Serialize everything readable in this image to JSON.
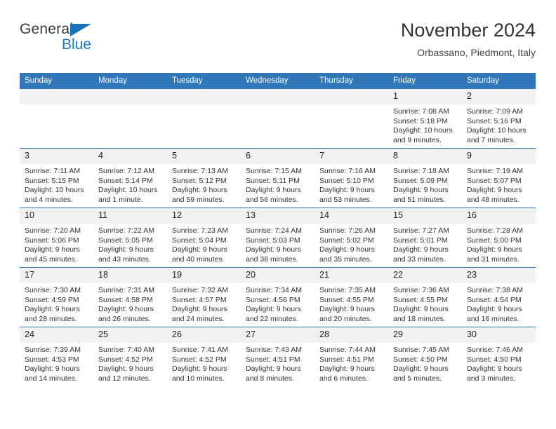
{
  "brand": {
    "line1": "General",
    "line2": "Blue",
    "flag_icon": "triangle-flag-icon",
    "accent_color": "#1a7bc4"
  },
  "header": {
    "title": "November 2024",
    "subtitle": "Orbassano, Piedmont, Italy"
  },
  "theme": {
    "header_blue": "#3176b7",
    "daynum_band": "#f1f1f1",
    "text": "#333333"
  },
  "calendar": {
    "weekday_headers": [
      "Sunday",
      "Monday",
      "Tuesday",
      "Wednesday",
      "Thursday",
      "Friday",
      "Saturday"
    ],
    "weeks": [
      [
        {
          "day": "",
          "blank": true
        },
        {
          "day": "",
          "blank": true
        },
        {
          "day": "",
          "blank": true
        },
        {
          "day": "",
          "blank": true
        },
        {
          "day": "",
          "blank": true
        },
        {
          "day": "1",
          "sunrise": "Sunrise: 7:08 AM",
          "sunset": "Sunset: 5:18 PM",
          "daylight": "Daylight: 10 hours and 9 minutes."
        },
        {
          "day": "2",
          "sunrise": "Sunrise: 7:09 AM",
          "sunset": "Sunset: 5:16 PM",
          "daylight": "Daylight: 10 hours and 7 minutes."
        }
      ],
      [
        {
          "day": "3",
          "sunrise": "Sunrise: 7:11 AM",
          "sunset": "Sunset: 5:15 PM",
          "daylight": "Daylight: 10 hours and 4 minutes."
        },
        {
          "day": "4",
          "sunrise": "Sunrise: 7:12 AM",
          "sunset": "Sunset: 5:14 PM",
          "daylight": "Daylight: 10 hours and 1 minute."
        },
        {
          "day": "5",
          "sunrise": "Sunrise: 7:13 AM",
          "sunset": "Sunset: 5:12 PM",
          "daylight": "Daylight: 9 hours and 59 minutes."
        },
        {
          "day": "6",
          "sunrise": "Sunrise: 7:15 AM",
          "sunset": "Sunset: 5:11 PM",
          "daylight": "Daylight: 9 hours and 56 minutes."
        },
        {
          "day": "7",
          "sunrise": "Sunrise: 7:16 AM",
          "sunset": "Sunset: 5:10 PM",
          "daylight": "Daylight: 9 hours and 53 minutes."
        },
        {
          "day": "8",
          "sunrise": "Sunrise: 7:18 AM",
          "sunset": "Sunset: 5:09 PM",
          "daylight": "Daylight: 9 hours and 51 minutes."
        },
        {
          "day": "9",
          "sunrise": "Sunrise: 7:19 AM",
          "sunset": "Sunset: 5:07 PM",
          "daylight": "Daylight: 9 hours and 48 minutes."
        }
      ],
      [
        {
          "day": "10",
          "sunrise": "Sunrise: 7:20 AM",
          "sunset": "Sunset: 5:06 PM",
          "daylight": "Daylight: 9 hours and 45 minutes."
        },
        {
          "day": "11",
          "sunrise": "Sunrise: 7:22 AM",
          "sunset": "Sunset: 5:05 PM",
          "daylight": "Daylight: 9 hours and 43 minutes."
        },
        {
          "day": "12",
          "sunrise": "Sunrise: 7:23 AM",
          "sunset": "Sunset: 5:04 PM",
          "daylight": "Daylight: 9 hours and 40 minutes."
        },
        {
          "day": "13",
          "sunrise": "Sunrise: 7:24 AM",
          "sunset": "Sunset: 5:03 PM",
          "daylight": "Daylight: 9 hours and 38 minutes."
        },
        {
          "day": "14",
          "sunrise": "Sunrise: 7:26 AM",
          "sunset": "Sunset: 5:02 PM",
          "daylight": "Daylight: 9 hours and 35 minutes."
        },
        {
          "day": "15",
          "sunrise": "Sunrise: 7:27 AM",
          "sunset": "Sunset: 5:01 PM",
          "daylight": "Daylight: 9 hours and 33 minutes."
        },
        {
          "day": "16",
          "sunrise": "Sunrise: 7:28 AM",
          "sunset": "Sunset: 5:00 PM",
          "daylight": "Daylight: 9 hours and 31 minutes."
        }
      ],
      [
        {
          "day": "17",
          "sunrise": "Sunrise: 7:30 AM",
          "sunset": "Sunset: 4:59 PM",
          "daylight": "Daylight: 9 hours and 28 minutes."
        },
        {
          "day": "18",
          "sunrise": "Sunrise: 7:31 AM",
          "sunset": "Sunset: 4:58 PM",
          "daylight": "Daylight: 9 hours and 26 minutes."
        },
        {
          "day": "19",
          "sunrise": "Sunrise: 7:32 AM",
          "sunset": "Sunset: 4:57 PM",
          "daylight": "Daylight: 9 hours and 24 minutes."
        },
        {
          "day": "20",
          "sunrise": "Sunrise: 7:34 AM",
          "sunset": "Sunset: 4:56 PM",
          "daylight": "Daylight: 9 hours and 22 minutes."
        },
        {
          "day": "21",
          "sunrise": "Sunrise: 7:35 AM",
          "sunset": "Sunset: 4:55 PM",
          "daylight": "Daylight: 9 hours and 20 minutes."
        },
        {
          "day": "22",
          "sunrise": "Sunrise: 7:36 AM",
          "sunset": "Sunset: 4:55 PM",
          "daylight": "Daylight: 9 hours and 18 minutes."
        },
        {
          "day": "23",
          "sunrise": "Sunrise: 7:38 AM",
          "sunset": "Sunset: 4:54 PM",
          "daylight": "Daylight: 9 hours and 16 minutes."
        }
      ],
      [
        {
          "day": "24",
          "sunrise": "Sunrise: 7:39 AM",
          "sunset": "Sunset: 4:53 PM",
          "daylight": "Daylight: 9 hours and 14 minutes."
        },
        {
          "day": "25",
          "sunrise": "Sunrise: 7:40 AM",
          "sunset": "Sunset: 4:52 PM",
          "daylight": "Daylight: 9 hours and 12 minutes."
        },
        {
          "day": "26",
          "sunrise": "Sunrise: 7:41 AM",
          "sunset": "Sunset: 4:52 PM",
          "daylight": "Daylight: 9 hours and 10 minutes."
        },
        {
          "day": "27",
          "sunrise": "Sunrise: 7:43 AM",
          "sunset": "Sunset: 4:51 PM",
          "daylight": "Daylight: 9 hours and 8 minutes."
        },
        {
          "day": "28",
          "sunrise": "Sunrise: 7:44 AM",
          "sunset": "Sunset: 4:51 PM",
          "daylight": "Daylight: 9 hours and 6 minutes."
        },
        {
          "day": "29",
          "sunrise": "Sunrise: 7:45 AM",
          "sunset": "Sunset: 4:50 PM",
          "daylight": "Daylight: 9 hours and 5 minutes."
        },
        {
          "day": "30",
          "sunrise": "Sunrise: 7:46 AM",
          "sunset": "Sunset: 4:50 PM",
          "daylight": "Daylight: 9 hours and 3 minutes."
        }
      ]
    ]
  }
}
